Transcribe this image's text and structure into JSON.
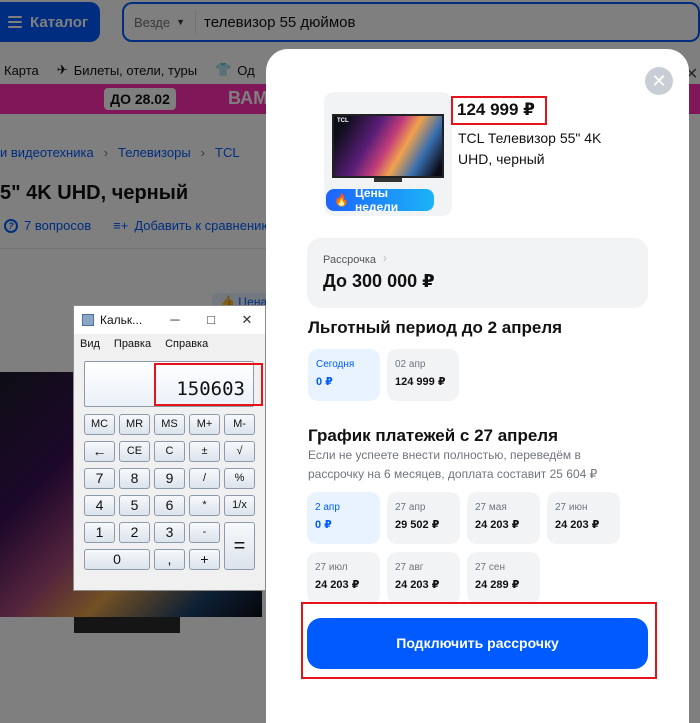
{
  "header": {
    "catalog_label": "Каталог",
    "search_scope": "Везде",
    "search_query": "телевизор 55 дюймов"
  },
  "nav": {
    "items": [
      "Карта",
      "Билеты, отели, туры",
      "Од"
    ]
  },
  "banner": {
    "date": "ДО 28.02",
    "word": "ВАМ"
  },
  "breadcrumb": [
    "и видеотехника",
    "Телевизоры",
    "TCL"
  ],
  "product_page": {
    "title": "5\" 4K UHD, черный",
    "questions": "7 вопросов",
    "compare": "Добавить к сравнению",
    "like_chip": "Цена"
  },
  "calculator": {
    "title": "Кальк...",
    "menu": [
      "Вид",
      "Правка",
      "Справка"
    ],
    "display": "150603",
    "keys": [
      [
        "MC",
        "MR",
        "MS",
        "M+",
        "M-"
      ],
      [
        "←",
        "CE",
        "C",
        "±",
        "√"
      ],
      [
        "7",
        "8",
        "9",
        "/",
        "%"
      ],
      [
        "4",
        "5",
        "6",
        "*",
        "1/x"
      ],
      [
        "1",
        "2",
        "3",
        "-",
        "="
      ],
      [
        "0",
        ",",
        "+"
      ]
    ]
  },
  "modal": {
    "price": "124 999 ₽",
    "product_name": "TCL Телевизор 55\" 4K UHD, черный",
    "badge": "Цены недели",
    "credit_label": "Рассрочка",
    "credit_value": "До 300 000 ₽",
    "grace_title": "Льготный период до 2 апреля",
    "grace_tiles": [
      {
        "date": "Сегодня",
        "amount": "0 ₽",
        "active": true
      },
      {
        "date": "02 апр",
        "amount": "124 999 ₽",
        "active": false
      }
    ],
    "schedule_title": "График платежей с 27 апреля",
    "schedule_note": "Если не успеете внести полностью, переведём в рассрочку на 6 месяцев, доплата составит 25 604 ₽",
    "schedule_tiles": [
      {
        "date": "2 апр",
        "amount": "0 ₽",
        "active": true
      },
      {
        "date": "27 апр",
        "amount": "29 502 ₽",
        "active": false
      },
      {
        "date": "27 мая",
        "amount": "24 203 ₽",
        "active": false
      },
      {
        "date": "27 июн",
        "amount": "24 203 ₽",
        "active": false
      },
      {
        "date": "27 июл",
        "amount": "24 203 ₽",
        "active": false
      },
      {
        "date": "27 авг",
        "amount": "24 203 ₽",
        "active": false
      },
      {
        "date": "27 сен",
        "amount": "24 289 ₽",
        "active": false
      }
    ],
    "connect_button": "Подключить рассрочку"
  },
  "colors": {
    "accent": "#005bff",
    "banner": "#ff2fb2",
    "highlight": "#e5141a"
  }
}
